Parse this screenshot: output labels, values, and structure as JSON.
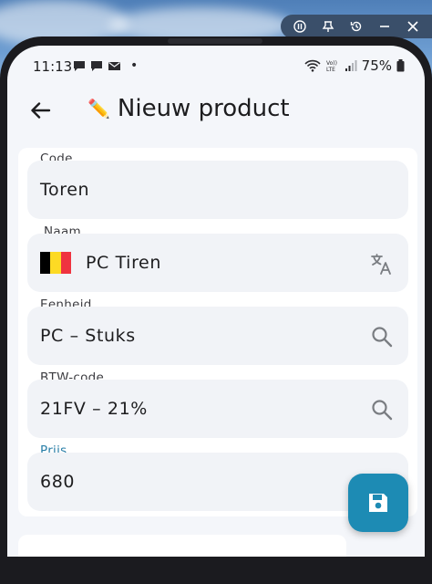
{
  "statusbar": {
    "time": "11:13",
    "battery": "75%",
    "dot": "•",
    "icons": [
      "chat-bubble-icon",
      "chat-bubble-icon",
      "mail-icon",
      "wifi-icon",
      "volte-icon",
      "signal-icon",
      "battery-icon"
    ]
  },
  "appbar": {
    "title_emoji": "✏️",
    "title": "Nieuw product"
  },
  "form": {
    "code": {
      "label": "Code",
      "value": "Toren"
    },
    "naam": {
      "label": "Naam",
      "value": "PC Tiren",
      "flag_colors": [
        "#000000",
        "#FDDA24",
        "#EF3340"
      ]
    },
    "eenheid": {
      "label": "Eenheid",
      "value": "PC – Stuks"
    },
    "btw": {
      "label": "BTW-code",
      "value": "21FV – 21%"
    },
    "prijs": {
      "label": "Prijs",
      "value": "680"
    }
  },
  "colors": {
    "accent": "#1d8bb4",
    "label_active": "#2a7fa8"
  }
}
